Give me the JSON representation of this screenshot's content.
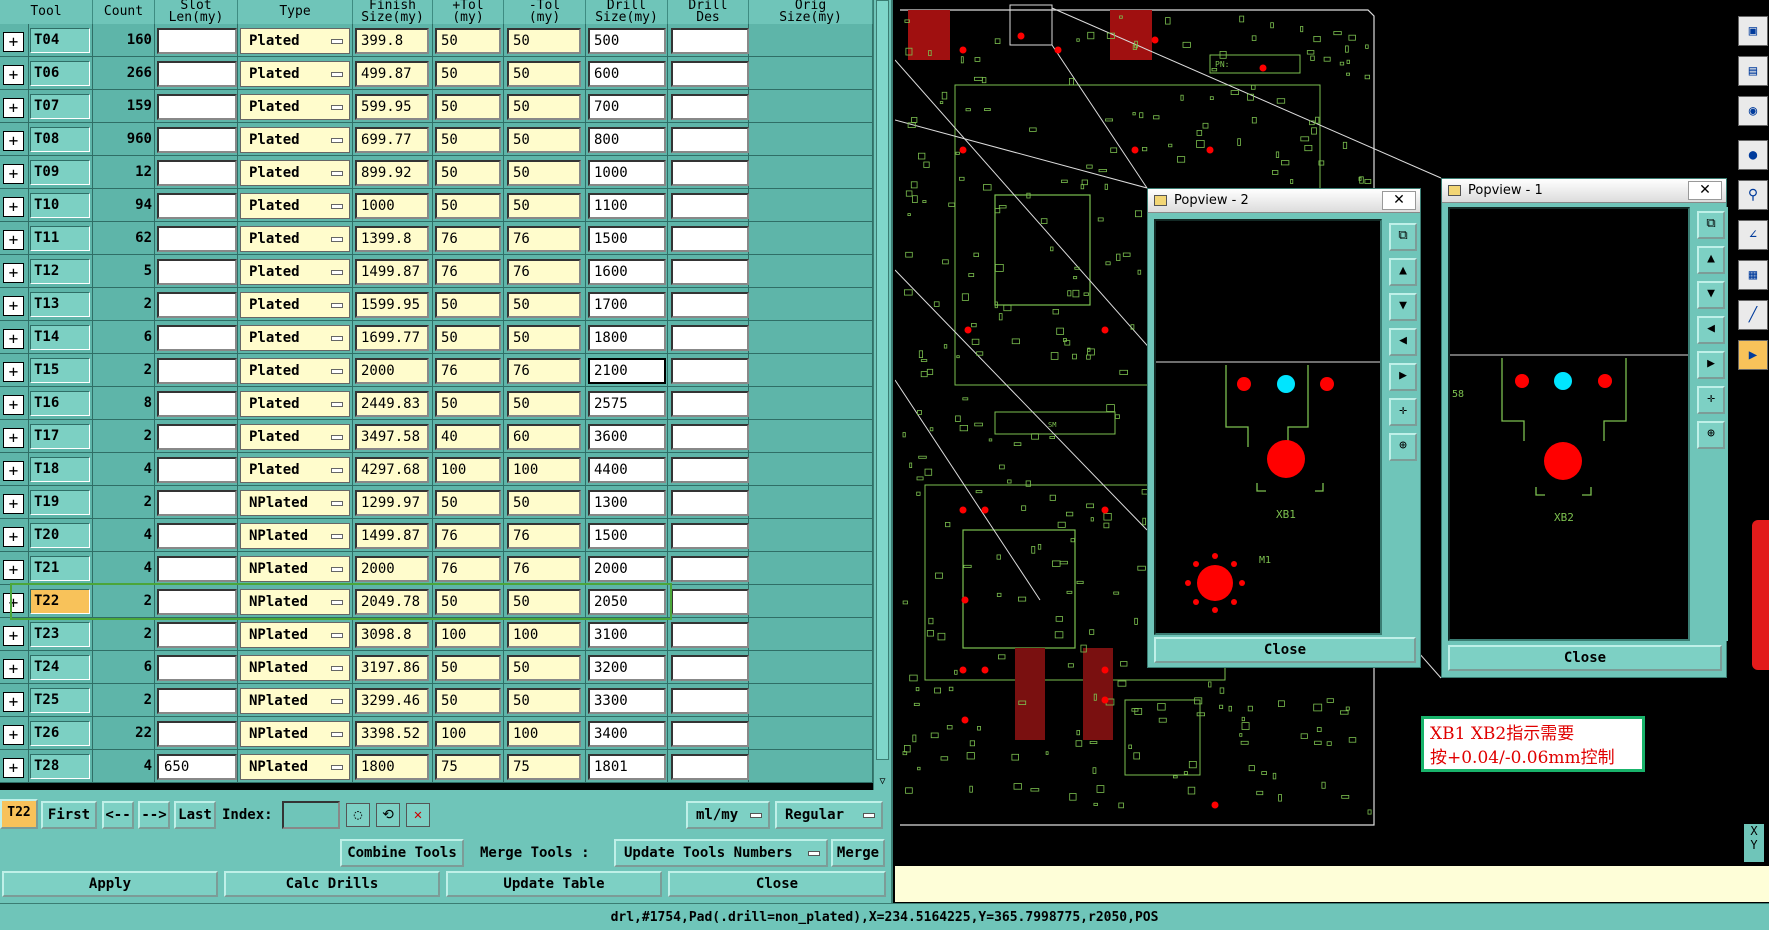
{
  "headers": [
    {
      "key": "tool",
      "label": "Tool"
    },
    {
      "key": "count",
      "label": "Count"
    },
    {
      "key": "slot",
      "label": "Slot\nLen(my)"
    },
    {
      "key": "type",
      "label": "Type"
    },
    {
      "key": "finish",
      "label": "Finish\nSize(my)"
    },
    {
      "key": "tolp",
      "label": "+Tol\n(my)"
    },
    {
      "key": "tolm",
      "label": "-Tol\n(my)"
    },
    {
      "key": "drill",
      "label": "Drill\nSize(my)"
    },
    {
      "key": "des",
      "label": "Drill\nDes"
    },
    {
      "key": "orig",
      "label": "Orig\nSize(my)"
    }
  ],
  "rows": [
    {
      "tool": "T04",
      "count": "160",
      "slot": "",
      "type": "Plated",
      "finish": "399.8",
      "tolp": "50",
      "tolm": "50",
      "drill": "500",
      "des": ""
    },
    {
      "tool": "T06",
      "count": "266",
      "slot": "",
      "type": "Plated",
      "finish": "499.87",
      "tolp": "50",
      "tolm": "50",
      "drill": "600",
      "des": ""
    },
    {
      "tool": "T07",
      "count": "159",
      "slot": "",
      "type": "Plated",
      "finish": "599.95",
      "tolp": "50",
      "tolm": "50",
      "drill": "700",
      "des": ""
    },
    {
      "tool": "T08",
      "count": "960",
      "slot": "",
      "type": "Plated",
      "finish": "699.77",
      "tolp": "50",
      "tolm": "50",
      "drill": "800",
      "des": ""
    },
    {
      "tool": "T09",
      "count": "12",
      "slot": "",
      "type": "Plated",
      "finish": "899.92",
      "tolp": "50",
      "tolm": "50",
      "drill": "1000",
      "des": ""
    },
    {
      "tool": "T10",
      "count": "94",
      "slot": "",
      "type": "Plated",
      "finish": "1000",
      "tolp": "50",
      "tolm": "50",
      "drill": "1100",
      "des": ""
    },
    {
      "tool": "T11",
      "count": "62",
      "slot": "",
      "type": "Plated",
      "finish": "1399.8",
      "tolp": "76",
      "tolm": "76",
      "drill": "1500",
      "des": ""
    },
    {
      "tool": "T12",
      "count": "5",
      "slot": "",
      "type": "Plated",
      "finish": "1499.87",
      "tolp": "76",
      "tolm": "76",
      "drill": "1600",
      "des": ""
    },
    {
      "tool": "T13",
      "count": "2",
      "slot": "",
      "type": "Plated",
      "finish": "1599.95",
      "tolp": "50",
      "tolm": "50",
      "drill": "1700",
      "des": ""
    },
    {
      "tool": "T14",
      "count": "6",
      "slot": "",
      "type": "Plated",
      "finish": "1699.77",
      "tolp": "50",
      "tolm": "50",
      "drill": "1800",
      "des": ""
    },
    {
      "tool": "T15",
      "count": "2",
      "slot": "",
      "type": "Plated",
      "finish": "2000",
      "tolp": "76",
      "tolm": "76",
      "drill": "2100",
      "des": ""
    },
    {
      "tool": "T16",
      "count": "8",
      "slot": "",
      "type": "Plated",
      "finish": "2449.83",
      "tolp": "50",
      "tolm": "50",
      "drill": "2575",
      "des": ""
    },
    {
      "tool": "T17",
      "count": "2",
      "slot": "",
      "type": "Plated",
      "finish": "3497.58",
      "tolp": "40",
      "tolm": "60",
      "drill": "3600",
      "des": ""
    },
    {
      "tool": "T18",
      "count": "4",
      "slot": "",
      "type": "Plated",
      "finish": "4297.68",
      "tolp": "100",
      "tolm": "100",
      "drill": "4400",
      "des": ""
    },
    {
      "tool": "T19",
      "count": "2",
      "slot": "",
      "type": "NPlated",
      "finish": "1299.97",
      "tolp": "50",
      "tolm": "50",
      "drill": "1300",
      "des": ""
    },
    {
      "tool": "T20",
      "count": "4",
      "slot": "",
      "type": "NPlated",
      "finish": "1499.87",
      "tolp": "76",
      "tolm": "76",
      "drill": "1500",
      "des": ""
    },
    {
      "tool": "T21",
      "count": "4",
      "slot": "",
      "type": "NPlated",
      "finish": "2000",
      "tolp": "76",
      "tolm": "76",
      "drill": "2000",
      "des": ""
    },
    {
      "tool": "T22",
      "count": "2",
      "slot": "",
      "type": "NPlated",
      "finish": "2049.78",
      "tolp": "50",
      "tolm": "50",
      "drill": "2050",
      "des": ""
    },
    {
      "tool": "T23",
      "count": "2",
      "slot": "",
      "type": "NPlated",
      "finish": "3098.8",
      "tolp": "100",
      "tolm": "100",
      "drill": "3100",
      "des": ""
    },
    {
      "tool": "T24",
      "count": "6",
      "slot": "",
      "type": "NPlated",
      "finish": "3197.86",
      "tolp": "50",
      "tolm": "50",
      "drill": "3200",
      "des": ""
    },
    {
      "tool": "T25",
      "count": "2",
      "slot": "",
      "type": "NPlated",
      "finish": "3299.46",
      "tolp": "50",
      "tolm": "50",
      "drill": "3300",
      "des": ""
    },
    {
      "tool": "T26",
      "count": "22",
      "slot": "",
      "type": "NPlated",
      "finish": "3398.52",
      "tolp": "100",
      "tolm": "100",
      "drill": "3400",
      "des": ""
    },
    {
      "tool": "T28",
      "count": "4",
      "slot": "650",
      "type": "NPlated",
      "finish": "1800",
      "tolp": "75",
      "tolm": "75",
      "drill": "1801",
      "des": ""
    }
  ],
  "selected_tool": "T22",
  "focused_drill_tool": "T15",
  "nav": {
    "current": "T22",
    "first": "First",
    "prev": "<--",
    "next": "-->",
    "last": "Last",
    "index_label": "Index:",
    "index_value": "",
    "units": "ml/my",
    "mode": "Regular"
  },
  "toolbar2": {
    "combine": "Combine Tools",
    "merge_label": "Merge Tools :",
    "update_numbers": "Update Tools Numbers",
    "merge": "Merge"
  },
  "actions": {
    "apply": "Apply",
    "calc": "Calc Drills",
    "update": "Update Table",
    "close": "Close"
  },
  "popview2": {
    "title": "Popview - 2",
    "close_x": "✕",
    "close": "Close",
    "silk_label": "XB1",
    "small_label": "M1"
  },
  "popview1": {
    "title": "Popview - 1",
    "close_x": "✕",
    "close": "Close",
    "silk_label": "XB2",
    "edge_label": "58"
  },
  "note": {
    "line1": "XB1 XB2指示需要",
    "line2": "按+0.04/-0.06mm控制"
  },
  "pcb_labels": {
    "pn": "PN:",
    "chip": "SM"
  },
  "status": "drl,#1754,Pad(.drill=non_plated),X=234.5164225,Y=365.7998775,r2050,POS",
  "xy_label": "X\nY",
  "colors": {
    "panel": "#6fc5b9",
    "field_yellow": "#fffccc",
    "selected": "#f8c25a",
    "pcb_trace": "#7cc04f",
    "pad_red": "#ff0000",
    "pad_cyan": "#00e5ff"
  }
}
